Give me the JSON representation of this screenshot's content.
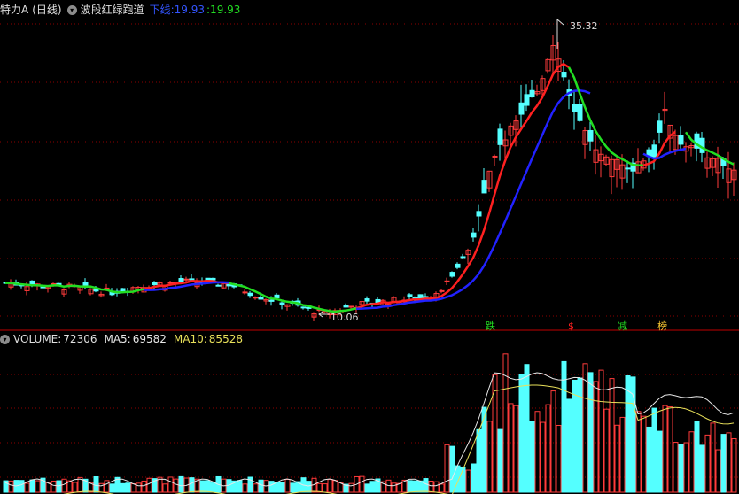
{
  "header": {
    "stock_name": "特力A",
    "period": "(日线)",
    "indicator_name": "波段红绿跑道",
    "down_label": "下线:",
    "down_value": "19.93",
    "up_value": ":19.93"
  },
  "volume_header": {
    "volume_label": "VOLUME:",
    "volume_value": "72306",
    "ma5_label": "MA5:",
    "ma5_value": "69582",
    "ma10_label": "MA10:",
    "ma10_value": "85528"
  },
  "annotations": {
    "high_label": "35.32",
    "low_label": "10.06",
    "signal_1": "跌",
    "signal_2": "$",
    "signal_3": "减",
    "signal_4": "榜"
  },
  "colors": {
    "up": "#ff3b3b",
    "down": "#54ffff",
    "channel_green": "#22dd22",
    "channel_red": "#ff2020",
    "channel_blue": "#2222ff",
    "ma5": "#e8e8e8",
    "ma10": "#e8e05a",
    "grid": "#8b0000"
  },
  "chart_data": {
    "type": "candlestick",
    "price_high": 35.32,
    "price_low": 10.06,
    "volume": {
      "last": 72306,
      "ma5": 69582,
      "ma10": 85528
    }
  }
}
